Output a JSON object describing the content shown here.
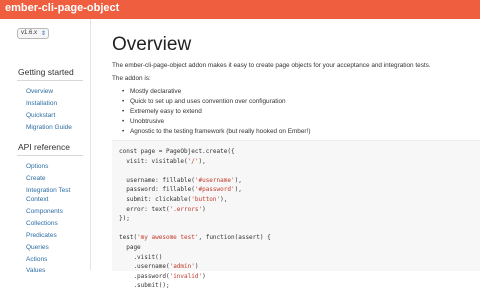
{
  "brand": "ember-cli-page-object",
  "version_select": {
    "value": "v1.6.x"
  },
  "sidebar": {
    "sections": [
      {
        "heading": "Getting started",
        "items": [
          {
            "label": "Overview",
            "active": true
          },
          {
            "label": "Installation"
          },
          {
            "label": "Quickstart"
          },
          {
            "label": "Migration Guide"
          }
        ]
      },
      {
        "heading": "API reference",
        "items": [
          {
            "label": "Options"
          },
          {
            "label": "Create"
          },
          {
            "label": "Integration Test"
          },
          {
            "label": "Context"
          },
          {
            "label": "Components"
          },
          {
            "label": "Collections"
          },
          {
            "label": "Predicates"
          },
          {
            "label": "Queries"
          },
          {
            "label": "Actions"
          },
          {
            "label": "Values"
          }
        ]
      }
    ]
  },
  "main": {
    "title": "Overview",
    "intro": "The ember-cli-page-object addon makes it easy to create page objects for your acceptance and integration tests.",
    "addon_is": "The addon is:",
    "bullets": [
      "Mostly declarative",
      "Quick to set up and uses convention over configuration",
      "Extremely easy to extend",
      "Unobtrusive",
      "Agnostic to the testing framework (but really hooked on Ember!)"
    ]
  },
  "code": {
    "lines": [
      "const page = PageObject.create({",
      "  visit: visitable('/'),",
      "",
      "  username: fillable('#username'),",
      "  password: fillable('#password'),",
      "  submit: clickable('button'),",
      "  error: text('.errors')",
      "});",
      "",
      "test('my awesome test', function(assert) {",
      "  page",
      "    .visit()",
      "    .username('admin')",
      "    .password('invalid')",
      "    .submit();"
    ]
  },
  "colors": {
    "topbar": "#ef5f3f",
    "link": "#2d6da3",
    "string": "#c23a2a"
  }
}
